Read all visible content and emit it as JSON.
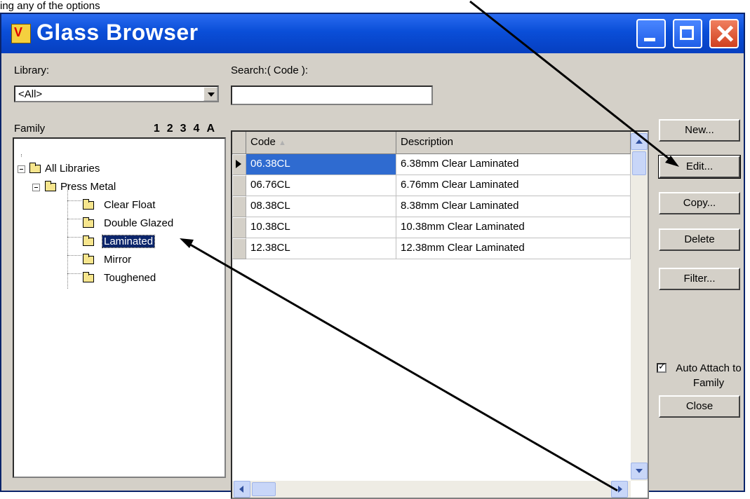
{
  "caption": "ing any of the options",
  "window": {
    "title": "Glass Browser"
  },
  "library": {
    "label": "Library:",
    "value": "<All>"
  },
  "search": {
    "label": "Search:( Code ):",
    "value": ""
  },
  "tree": {
    "header": "Family",
    "levels": "1234A",
    "nodes": [
      {
        "label": "All Libraries"
      },
      {
        "label": "Press Metal"
      },
      {
        "label": "Clear Float"
      },
      {
        "label": "Double Glazed"
      },
      {
        "label": "Laminated"
      },
      {
        "label": "Mirror"
      },
      {
        "label": "Toughened"
      }
    ]
  },
  "grid": {
    "columns": [
      "Code",
      "Description"
    ],
    "rows": [
      {
        "code": "06.38CL",
        "description": "6.38mm Clear Laminated"
      },
      {
        "code": "06.76CL",
        "description": "6.76mm Clear Laminated"
      },
      {
        "code": "08.38CL",
        "description": "8.38mm Clear Laminated"
      },
      {
        "code": "10.38CL",
        "description": "10.38mm Clear Laminated"
      },
      {
        "code": "12.38CL",
        "description": "12.38mm Clear Laminated"
      }
    ]
  },
  "buttons": {
    "new": "New...",
    "edit": "Edit...",
    "copy": "Copy...",
    "delete": "Delete",
    "filter": "Filter...",
    "close": "Close"
  },
  "auto_attach": {
    "label": "Auto Attach to Family",
    "checked": true
  }
}
